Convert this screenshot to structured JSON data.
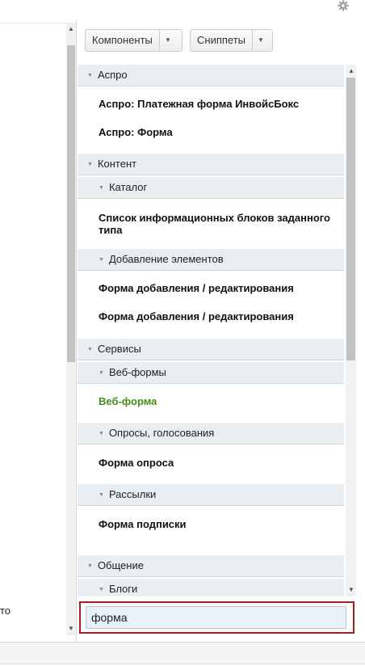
{
  "toolbar": {
    "components_label": "Компоненты",
    "snippets_label": "Сниппеты",
    "dropdown_icon": "chevron-down-icon",
    "settings_icon": "gear-icon"
  },
  "editor": {
    "left_tail_text": "то"
  },
  "tree": {
    "categories": {
      "aspro": "Аспро",
      "content": "Контент",
      "catalog": "Каталог",
      "add_elements": "Добавление элементов",
      "services": "Сервисы",
      "webforms": "Веб-формы",
      "polls": "Опросы, голосования",
      "mailings": "Рассылки",
      "communication": "Общение",
      "blogs": "Блоги"
    },
    "items": {
      "aspro_payment": "Аспро: Платежная форма ИнвойсБокс",
      "aspro_form": "Аспро: Форма",
      "iblock_list": "Список информационных блоков заданного типа",
      "add_form_1": "Форма добавления / редактирования",
      "add_form_2": "Форма добавления / редактирования",
      "webform": "Веб-форма",
      "poll_form": "Форма опроса",
      "subscribe_form": "Форма подписки"
    }
  },
  "search": {
    "value": "форма"
  },
  "colors": {
    "highlight_item": "#4a8a1a",
    "search_border": "#a71f1f",
    "category_bg": "#e8eef1"
  }
}
